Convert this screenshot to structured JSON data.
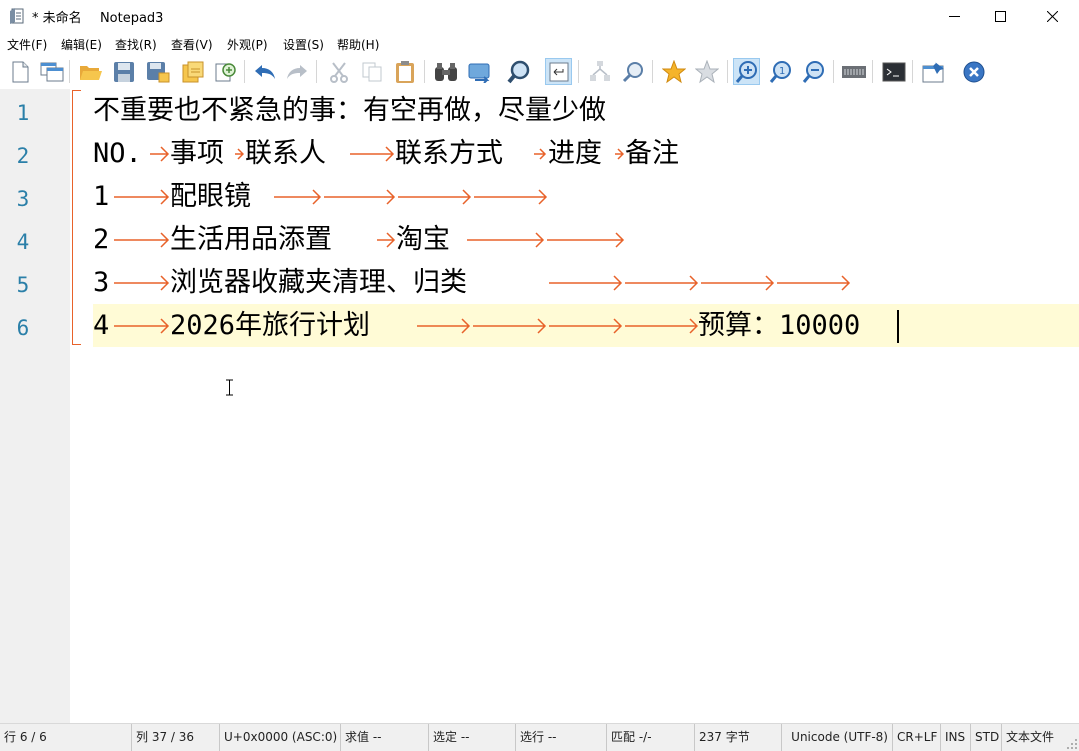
{
  "window": {
    "title_modified": "*",
    "title_filename": "未命名",
    "title_app": "Notepad3"
  },
  "menu": {
    "items": [
      "文件(F)",
      "编辑(E)",
      "查找(R)",
      "查看(V)",
      "外观(P)",
      "设置(S)",
      "帮助(H)"
    ]
  },
  "toolbar": {
    "buttons": [
      "new-file-icon",
      "new-window-icon",
      "open-folder-icon",
      "save-icon",
      "save-as-icon",
      "save-copy-icon",
      "browse-icon",
      "undo-icon",
      "redo-icon",
      "cut-icon",
      "copy-icon",
      "paste-icon",
      "find-icon",
      "replace-icon",
      "find-next-icon",
      "word-wrap-icon",
      "indent-guide-icon",
      "zoom-lens-icon",
      "favorite-icon",
      "add-favorite-icon",
      "zoom-in-icon",
      "zoom-reset-icon",
      "zoom-out-icon",
      "encoding-icon",
      "terminal-icon",
      "pin-icon",
      "exit-icon"
    ],
    "active_button": "word-wrap-icon"
  },
  "editor": {
    "line_numbers": [
      "1",
      "2",
      "3",
      "4",
      "5",
      "6"
    ],
    "current_line": 6,
    "lines": [
      {
        "segments": [
          "不重要也不紧急的事：有空再做，尽量少做"
        ]
      },
      {
        "segments": [
          "NO.",
          "事项",
          "联系人",
          "联系方式",
          "进度",
          "备注"
        ]
      },
      {
        "segments": [
          "1",
          "配眼镜"
        ]
      },
      {
        "segments": [
          "2",
          "生活用品添置",
          "淘宝"
        ]
      },
      {
        "segments": [
          "3",
          "浏览器收藏夹清理、归类"
        ]
      },
      {
        "segments": [
          "4",
          "2026年旅行计划",
          "预算：10000"
        ]
      }
    ],
    "colors": {
      "tab_arrow": "#e8622a",
      "line_number": "#2a7fa8",
      "current_line_bg": "#fffbd6",
      "gutter_bg": "#f0f0f0"
    }
  },
  "statusbar": {
    "line": "行  6 / 6",
    "column": "列  37 / 36",
    "unicode": "U+0x0000 (ASC:0)",
    "value": "求值  --",
    "selection": "选定  --",
    "selected_lines": "选行  --",
    "match": "匹配  -/-",
    "bytes": "237 字节",
    "encoding": "Unicode (UTF-8)",
    "eol": "CR+LF",
    "ins": "INS",
    "std": "STD",
    "lexer": "文本文件"
  }
}
